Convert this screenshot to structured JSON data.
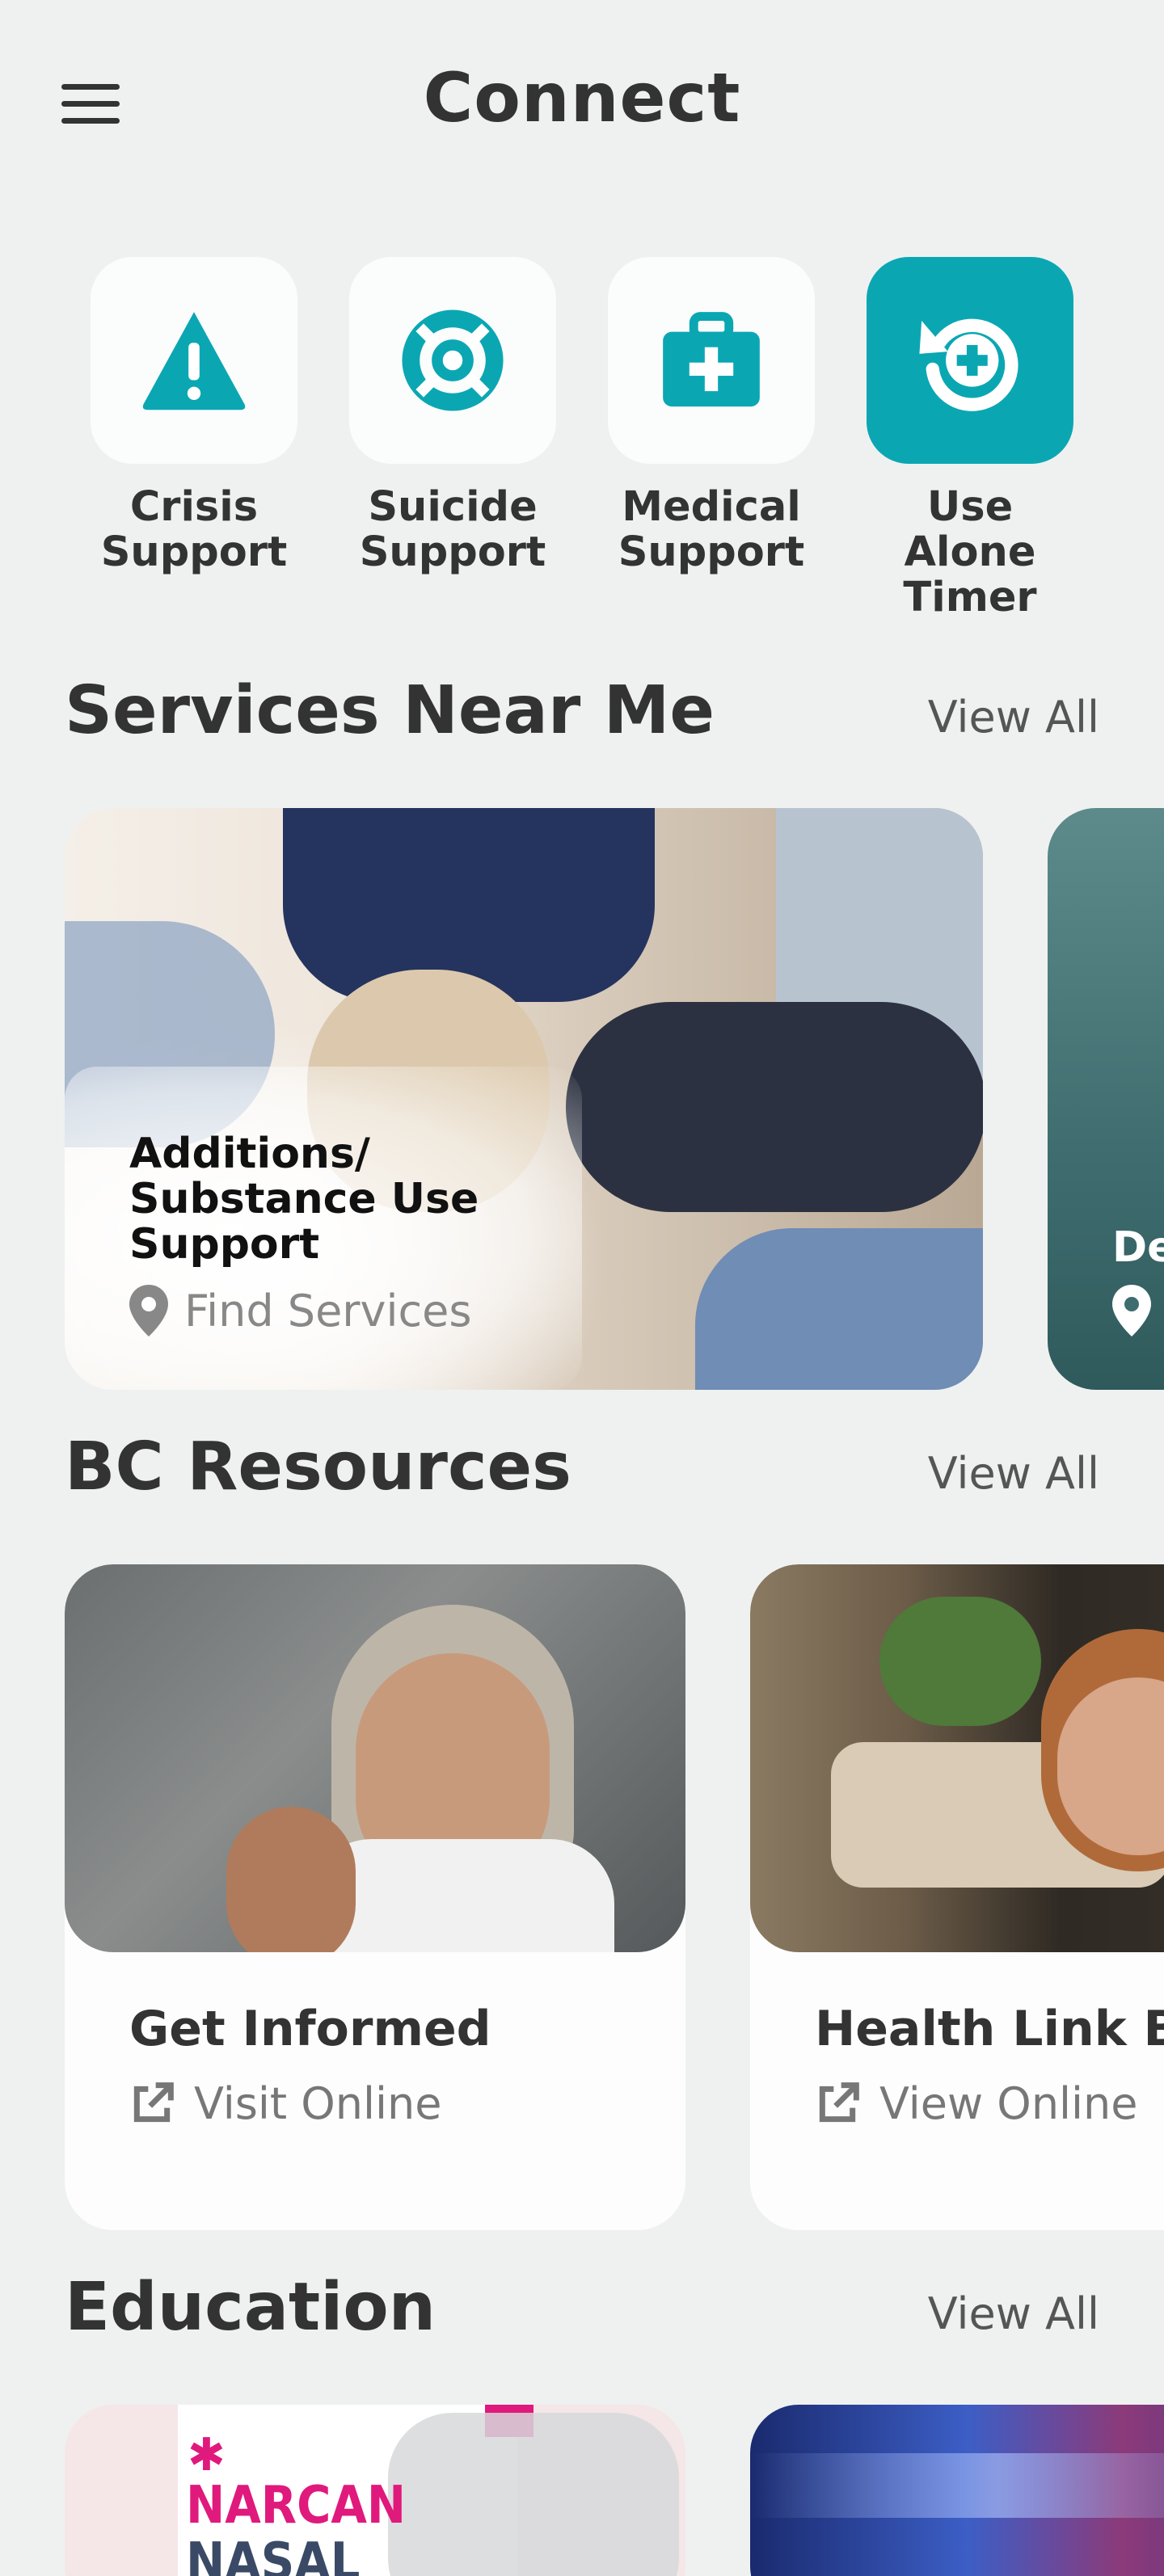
{
  "header": {
    "title": "Connect",
    "menu_icon": "hamburger-menu-icon"
  },
  "quick_actions": [
    {
      "label": "Crisis\nSupport",
      "icon": "warning-triangle-icon",
      "active": false
    },
    {
      "label": "Suicide\nSupport",
      "icon": "lifebuoy-icon",
      "active": false
    },
    {
      "label": "Medical\nSupport",
      "icon": "medical-kit-icon",
      "active": false
    },
    {
      "label": "Use Alone\nTimer",
      "icon": "timer-restart-icon",
      "active": true
    }
  ],
  "colors": {
    "accent": "#0aa7b3",
    "background": "#eff1f1",
    "text": "#333333"
  },
  "services": {
    "title": "Services Near Me",
    "view_all": "View All",
    "cards": [
      {
        "title": "Additions/\nSubstance Use\nSupport",
        "link": "Find Services",
        "icon": "location-pin-icon"
      },
      {
        "title": "De",
        "link": "",
        "icon": "location-pin-icon"
      }
    ]
  },
  "resources": {
    "title": "BC Resources",
    "view_all": "View All",
    "cards": [
      {
        "title": "Get Informed",
        "link": "Visit Online",
        "icon": "external-link-icon"
      },
      {
        "title": "Health Link BC",
        "link": "View Online",
        "icon": "external-link-icon"
      }
    ]
  },
  "education": {
    "title": "Education",
    "view_all": "View All",
    "cards": [
      {
        "image_text_1": "NARCAN",
        "image_text_2": "NASAL"
      },
      {}
    ]
  }
}
